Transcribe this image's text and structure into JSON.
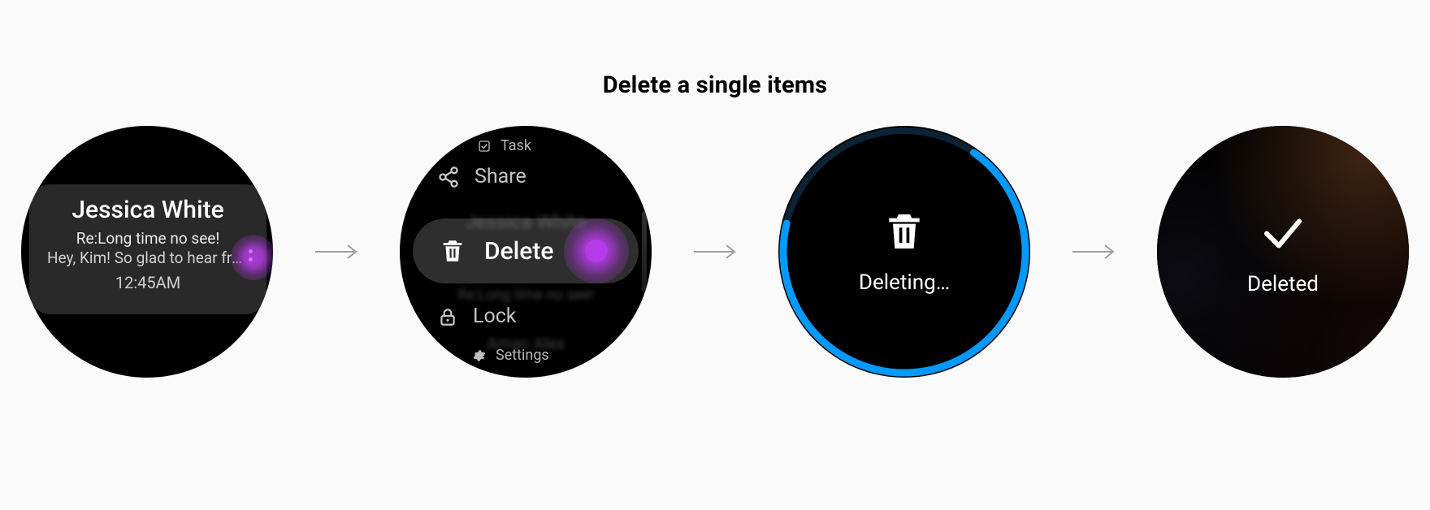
{
  "title": "Delete a single items",
  "screen1": {
    "name": "Jessica White",
    "subject": "Re:Long time no see!",
    "preview": "Hey, Kim! So glad to hear fro…",
    "time": "12:45AM"
  },
  "screen2": {
    "menu": {
      "task": "Task",
      "share": "Share",
      "delete": "Delete",
      "lock": "Lock",
      "settings": "Settings"
    }
  },
  "screen3": {
    "label": "Deleting…"
  },
  "screen4": {
    "label": "Deleted"
  },
  "icons": {
    "task": "task-icon",
    "share": "share-icon",
    "delete": "trash-icon",
    "lock": "lock-icon",
    "settings": "gear-icon",
    "check": "check-icon"
  },
  "colors": {
    "touch": "#b43bea",
    "ring": "#0099ff"
  }
}
